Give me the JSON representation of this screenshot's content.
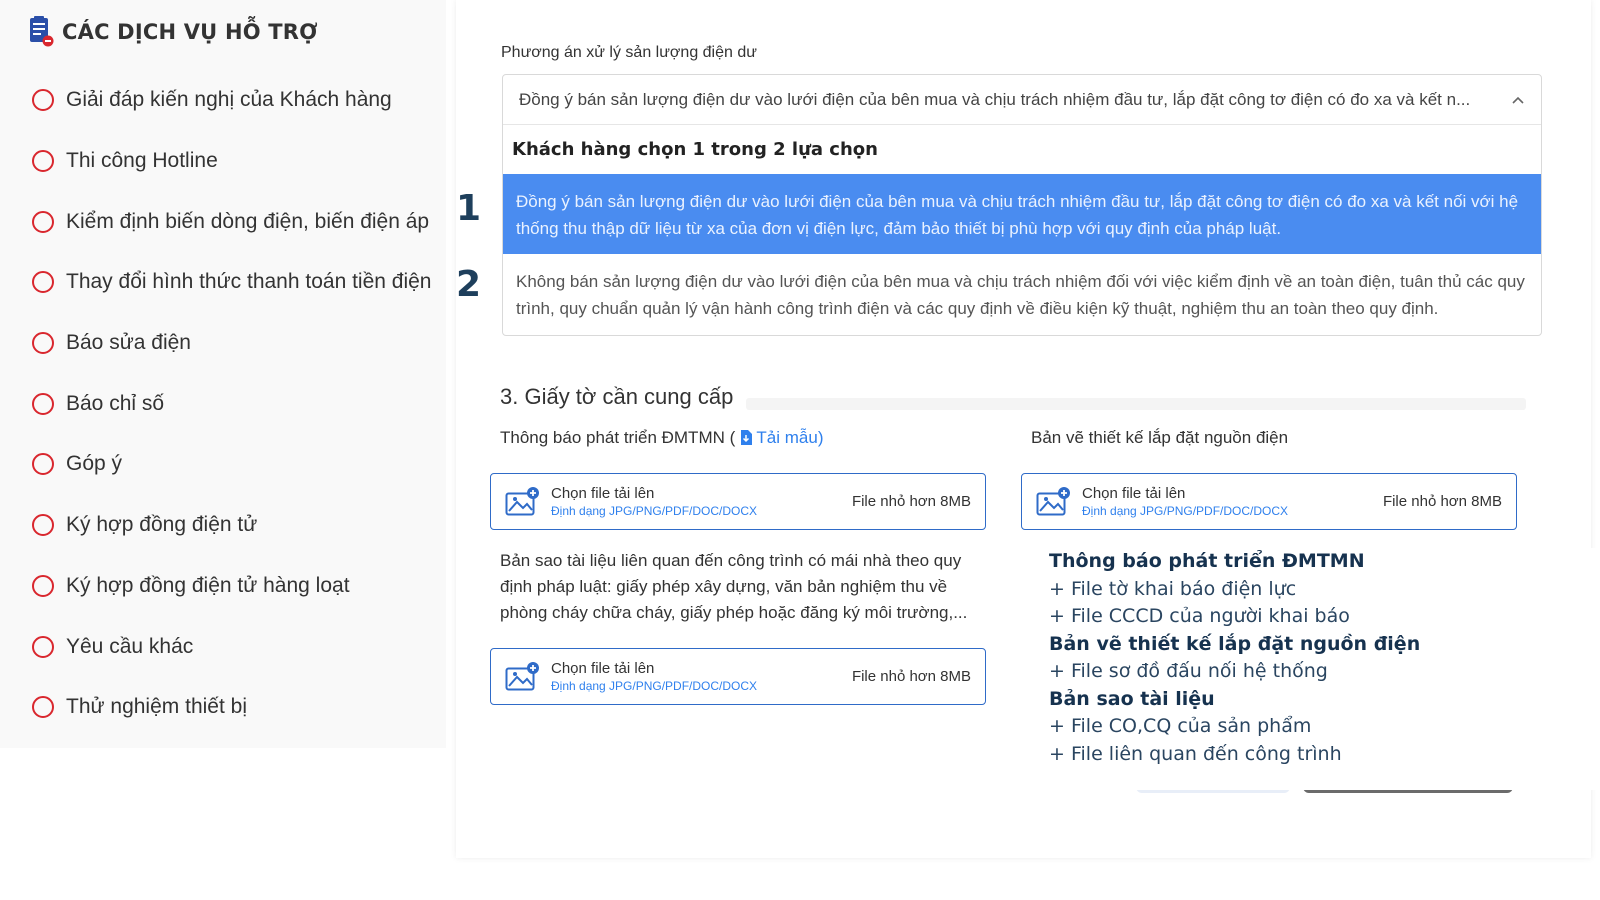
{
  "sidebar": {
    "title": "CÁC DỊCH VỤ HỖ TRỢ",
    "items": [
      {
        "label": "Giải đáp kiến nghị của Khách hàng"
      },
      {
        "label": "Thi công Hotline"
      },
      {
        "label": "Kiểm định biến dòng điện, biến điện áp"
      },
      {
        "label": "Thay đổi hình thức thanh toán tiền điện"
      },
      {
        "label": "Báo sửa điện"
      },
      {
        "label": "Báo chỉ số"
      },
      {
        "label": "Góp ý"
      },
      {
        "label": "Ký hợp đồng điện tử"
      },
      {
        "label": "Ký hợp đồng điện tử hàng loạt"
      },
      {
        "label": "Yêu cầu khác"
      },
      {
        "label": "Thử nghiệm thiết bị"
      }
    ]
  },
  "form": {
    "field_label": "Phương án xử lý sản lượng điện dư",
    "selected_value": "Đồng ý bán sản lượng điện dư vào lưới điện của bên mua và chịu trách nhiệm đầu tư, lắp đặt công tơ điện có đo xa và kết n...",
    "group_title": "Khách hàng chọn 1 trong 2 lựa chọn",
    "options": [
      {
        "number": "1",
        "text": "Đồng ý bán sản lượng điện dư vào lưới điện của bên mua và chịu trách nhiệm đầu tư, lắp đặt công tơ điện có đo xa và kết nối với hệ thống thu thập dữ liệu từ xa của đơn vị điện lực, đảm bảo thiết bị phù hợp với quy định của pháp luật."
      },
      {
        "number": "2",
        "text": "Không bán sản lượng điện dư vào lưới điện của bên mua và chịu trách nhiệm đối với việc kiểm định về an toàn điện, tuân thủ các quy trình, quy chuẩn quản lý vận hành công trình điện và các quy định về điều kiện kỹ thuật, nghiệm thu an toàn theo quy định."
      }
    ]
  },
  "documents": {
    "section_title": "3. Giấy tờ cần cung cấp",
    "doc1": {
      "title": "Thông báo phát triển ĐMTMN (",
      "link": "Tải mẫu",
      "close": ")"
    },
    "doc2": {
      "title": "Bản vẽ thiết kế lắp đặt nguồn điện"
    },
    "doc3": {
      "title": "Bản sao tài liệu liên quan đến công trình có mái nhà theo quy định pháp luật: giấy phép xây dựng, văn bản nghiệm thu về phòng cháy chữa cháy, giấy phép hoặc đăng ký môi trường,..."
    },
    "upload": {
      "title": "Chọn file tải lên",
      "hint": "Định dạng JPG/PNG/PDF/DOC/DOCX",
      "size": "File nhỏ hơn 8MB"
    }
  },
  "info": {
    "lines": [
      {
        "text": "Thông báo phát triển ĐMTMN",
        "kind": "h"
      },
      {
        "text": "+ File tờ khai báo điện lực",
        "kind": "i"
      },
      {
        "text": "+ File CCCD của người khai báo",
        "kind": "i"
      },
      {
        "text": "Bản vẽ thiết kế lắp đặt nguồn điện",
        "kind": "h"
      },
      {
        "text": "+ File sơ đồ đấu nối hệ thống",
        "kind": "i"
      },
      {
        "text": "Bản sao tài liệu",
        "kind": "h"
      },
      {
        "text": "+ File CO,CQ của sản phẩm",
        "kind": "i"
      },
      {
        "text": "+ File liên quan đến công trình",
        "kind": "i"
      }
    ]
  },
  "colors": {
    "accent_red": "#d9272e",
    "selected_blue": "#4a8cf0",
    "link_blue": "#2f80ed",
    "number_navy": "#1e3f5c"
  }
}
